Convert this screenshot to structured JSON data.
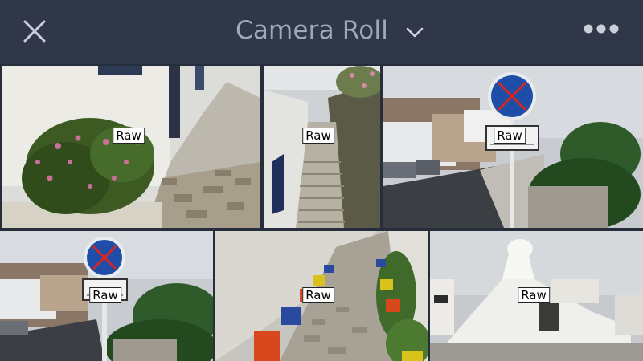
{
  "header": {
    "title": "Camera Roll",
    "close_icon": "close-icon",
    "dropdown_icon": "chevron-down-icon",
    "more_icon": "more-horizontal-icon"
  },
  "colors": {
    "header_bg": "#2f3749",
    "header_text": "#9ea8bc",
    "icon": "#c9d0dc"
  },
  "photos": [
    {
      "badge": "Raw",
      "subject": "flower bush beside white alley"
    },
    {
      "badge": "Raw",
      "subject": "narrow stone stairway"
    },
    {
      "badge": "Raw",
      "subject": "no-parking sign on street"
    },
    {
      "badge": "Raw",
      "subject": "no-parking sign and palm"
    },
    {
      "badge": "Raw",
      "subject": "painted flower pots in lane"
    },
    {
      "badge": "Raw",
      "subject": "white chapel"
    }
  ]
}
